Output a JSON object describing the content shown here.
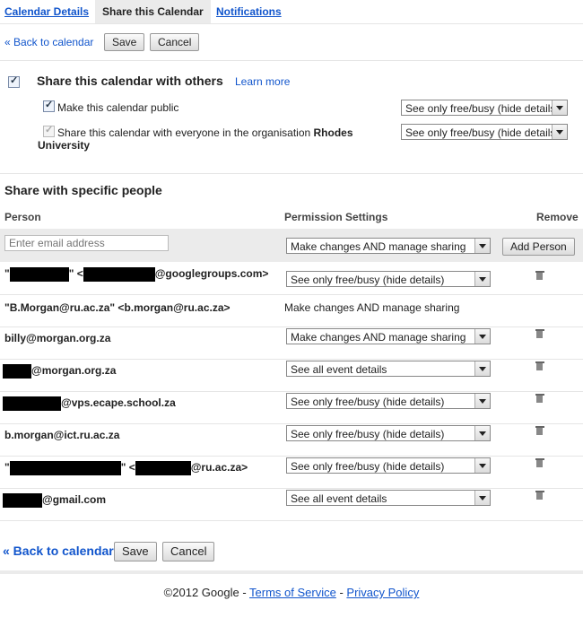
{
  "tabs": {
    "details": "Calendar Details",
    "share": "Share this Calendar",
    "notifications": "Notifications"
  },
  "top_actions": {
    "back": "« Back to calendar",
    "save": "Save",
    "cancel": "Cancel"
  },
  "share_section": {
    "heading": "Share this calendar with others",
    "learn_more": "Learn more",
    "public_label": "Make this calendar public",
    "public_setting": "See only free/busy (hide details)",
    "org_label_prefix": "Share this calendar with everyone in the organisation ",
    "org_name_1": "Rhodes",
    "org_name_2": "University",
    "org_setting": "See only free/busy (hide details)"
  },
  "specific": {
    "heading": "Share with specific people",
    "col_person": "Person",
    "col_permission": "Permission Settings",
    "col_remove": "Remove",
    "email_placeholder": "Enter email address",
    "new_permission": "Make changes AND manage sharing",
    "add_person": "Add Person"
  },
  "people": [
    {
      "prefix": "\"",
      "mid": "\" <",
      "suffix": "@googlegroups.com>",
      "permission": "See only free/busy (hide details)"
    },
    {
      "text": "\"B.Morgan@ru.ac.za\" <b.morgan@ru.ac.za>",
      "permission": "Make changes AND manage sharing"
    },
    {
      "text": "billy@morgan.org.za",
      "permission": "Make changes AND manage sharing"
    },
    {
      "suffix": "@morgan.org.za",
      "permission": "See all event details"
    },
    {
      "suffix": "@vps.ecape.school.za",
      "permission": "See only free/busy (hide details)"
    },
    {
      "text": "b.morgan@ict.ru.ac.za",
      "permission": "See only free/busy (hide details)"
    },
    {
      "prefix": "\"",
      "mid": "\" <",
      "suffix": "@ru.ac.za>",
      "permission": "See only free/busy (hide details)"
    },
    {
      "suffix": "@gmail.com",
      "permission": "See all event details"
    }
  ],
  "bottom_actions": {
    "back": "« Back to calendar",
    "save": "Save",
    "cancel": "Cancel"
  },
  "footer": {
    "copyright": "©2012 Google - ",
    "tos": "Terms of Service",
    "sep": " - ",
    "privacy": "Privacy Policy"
  }
}
